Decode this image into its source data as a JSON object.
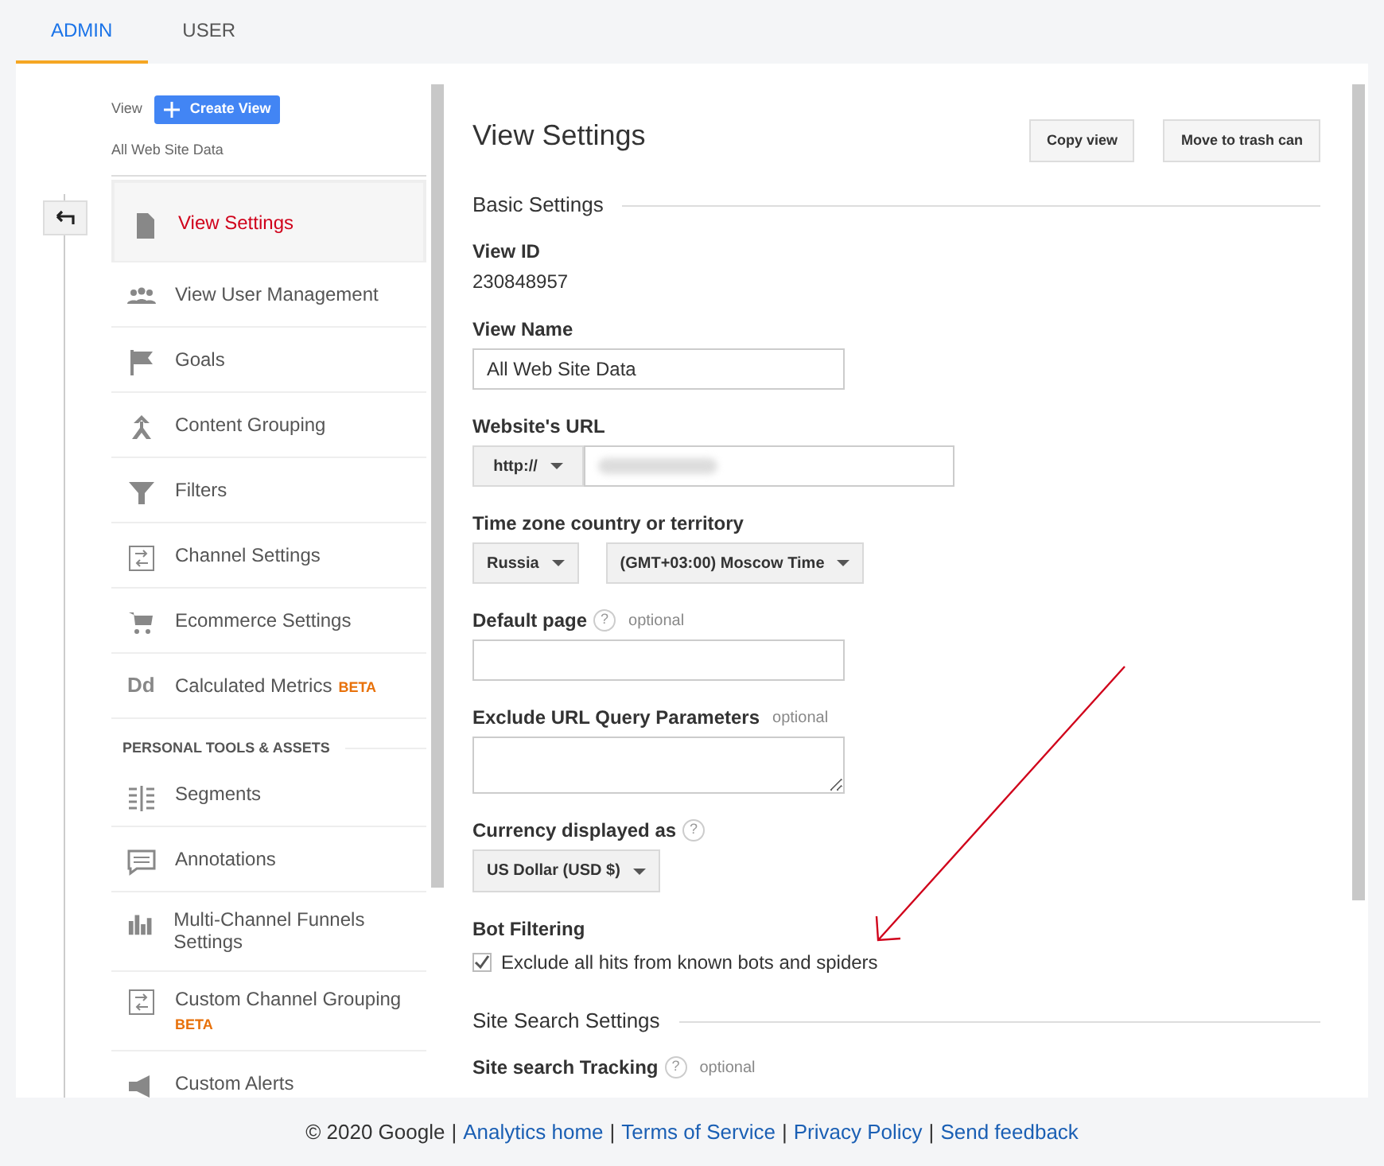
{
  "tabs": [
    {
      "label": "ADMIN",
      "selected": true
    },
    {
      "label": "USER",
      "selected": false
    }
  ],
  "sidebar": {
    "view_label": "View",
    "create_button": "Create View",
    "view_name": "All Web Site Data",
    "items": [
      {
        "kind": "item",
        "label": "View Settings",
        "selected": true
      },
      {
        "kind": "item",
        "label": "View User Management",
        "selected": false
      },
      {
        "kind": "item",
        "label": "Goals",
        "selected": false
      },
      {
        "kind": "item",
        "label": "Content Grouping",
        "selected": false
      },
      {
        "kind": "item",
        "label": "Filters",
        "selected": false
      },
      {
        "kind": "item",
        "label": "Channel Settings",
        "selected": false
      },
      {
        "kind": "item",
        "label": "Ecommerce Settings",
        "selected": false
      },
      {
        "kind": "item",
        "label": "Calculated Metrics",
        "icon_text": "Dd",
        "badge": "BETA",
        "selected": false
      },
      {
        "kind": "header",
        "label": "PERSONAL TOOLS & ASSETS"
      },
      {
        "kind": "item",
        "label": "Segments",
        "selected": false
      },
      {
        "kind": "item",
        "label": "Annotations",
        "selected": false
      },
      {
        "kind": "item",
        "label": "Multi-Channel Funnels Settings",
        "selected": false
      },
      {
        "kind": "item",
        "label": "Custom Channel Grouping",
        "badge": "BETA",
        "badge_below": true,
        "selected": false
      },
      {
        "kind": "item",
        "label": "Custom Alerts",
        "selected": false
      }
    ]
  },
  "main": {
    "title": "View Settings",
    "buttons": [
      "Copy view",
      "Move to trash can"
    ],
    "sections": [
      {
        "title": "Basic Settings",
        "fields": [
          {
            "kind": "text",
            "label": "View ID",
            "value": "230848957"
          },
          {
            "kind": "input",
            "label": "View Name",
            "value": "All Web Site Data"
          },
          {
            "kind": "url",
            "label": "Website's URL",
            "protocol": "http://"
          },
          {
            "kind": "selects",
            "label": "Time zone country or territory",
            "options": [
              "Russia",
              "(GMT+03:00) Moscow Time"
            ]
          },
          {
            "kind": "input",
            "label": "Default page",
            "help": "?",
            "optional": "optional"
          },
          {
            "kind": "textarea",
            "label": "Exclude URL Query Parameters",
            "optional": "optional"
          },
          {
            "kind": "select",
            "label": "Currency displayed as",
            "help": "?",
            "value": "US Dollar (USD $)"
          },
          {
            "kind": "checkbox",
            "label": "Bot Filtering",
            "text": "Exclude all hits from known bots and spiders",
            "checked": true
          }
        ]
      },
      {
        "title": "Site Search Settings",
        "fields": [
          {
            "kind": "label",
            "label": "Site search Tracking",
            "help": "?",
            "optional": "optional"
          }
        ]
      }
    ]
  },
  "footer": {
    "copyright": "© 2020 Google",
    "separator": "|",
    "links": [
      "Analytics home",
      "Terms of Service",
      "Privacy Policy",
      "Send feedback"
    ]
  }
}
